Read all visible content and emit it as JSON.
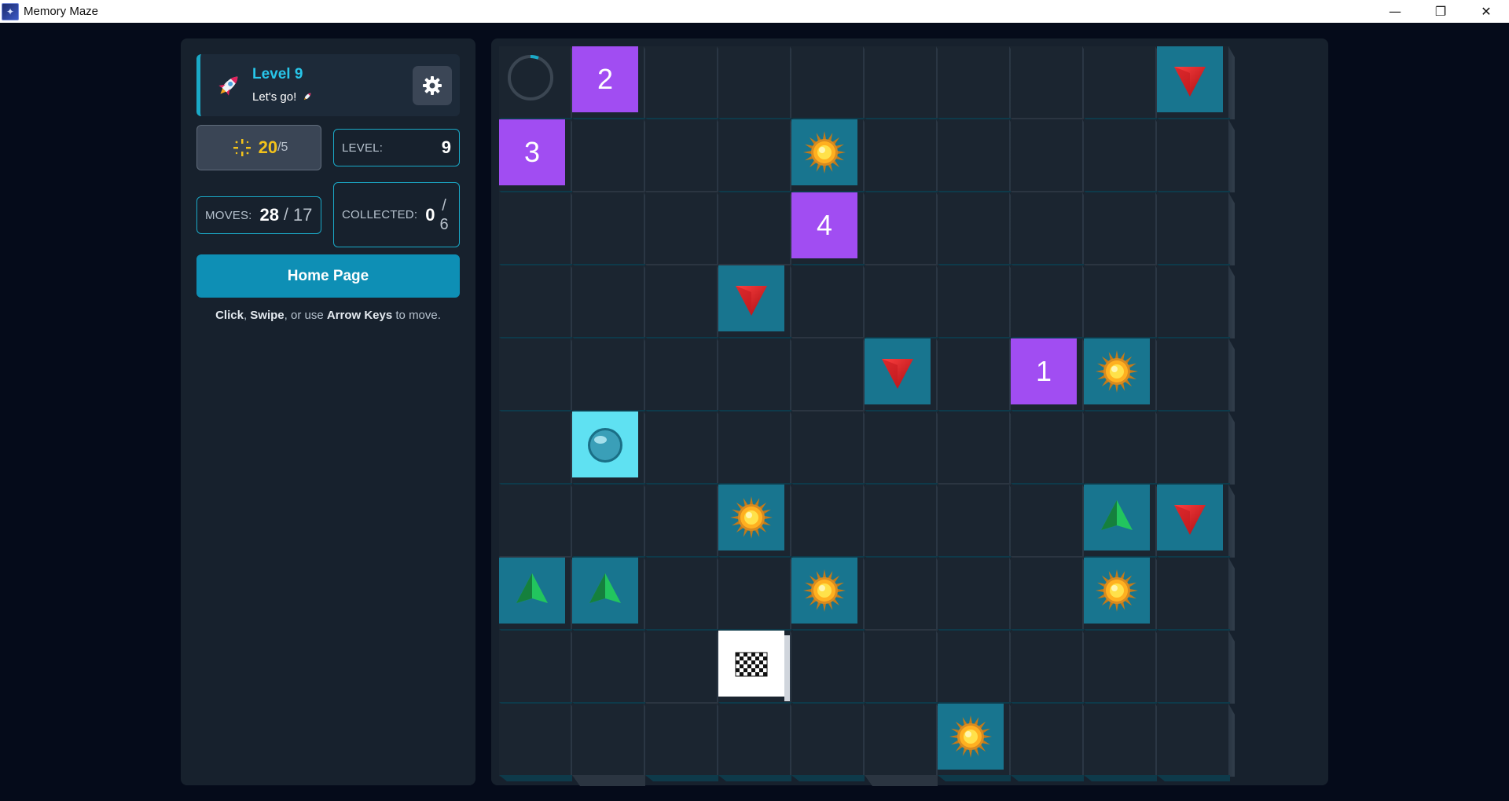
{
  "window": {
    "title": "Memory Maze",
    "controls": [
      "—",
      "❐",
      "✕"
    ]
  },
  "panel": {
    "level_title": "Level 9",
    "level_sub": "Let's go!",
    "score_main": "20",
    "score_sub": "/5",
    "level_label": "LEVEL:",
    "level_value": "9",
    "moves_label": "MOVES:",
    "moves_value": "28",
    "moves_sep": "/",
    "moves_max": "17",
    "collected_label": "COLLECTED:",
    "collected_value": "0",
    "collected_sep": "/",
    "collected_total": "6",
    "home_button": "Home Page",
    "hint": {
      "click": "Click",
      "comma": ", ",
      "swipe": "Swipe",
      "or_use": ", or use ",
      "arrow_keys": "Arrow Keys",
      "to_move": " to move."
    }
  },
  "board": {
    "rows": 10,
    "cols": 10,
    "timer_progress": 0.06,
    "colors": {
      "tile": "#18758f",
      "memo": "#a14df2",
      "player": "#5fe1f2",
      "accent": "#1aa9c7"
    },
    "tiles": [
      {
        "row": 0,
        "col": 1,
        "type": "memo",
        "label": "2"
      },
      {
        "row": 0,
        "col": 9,
        "type": "down-arrow"
      },
      {
        "row": 1,
        "col": 0,
        "type": "memo",
        "label": "3"
      },
      {
        "row": 1,
        "col": 4,
        "type": "sun"
      },
      {
        "row": 2,
        "col": 4,
        "type": "memo",
        "label": "4"
      },
      {
        "row": 3,
        "col": 3,
        "type": "down-arrow"
      },
      {
        "row": 4,
        "col": 5,
        "type": "down-arrow"
      },
      {
        "row": 4,
        "col": 7,
        "type": "memo",
        "label": "1"
      },
      {
        "row": 4,
        "col": 8,
        "type": "sun"
      },
      {
        "row": 5,
        "col": 1,
        "type": "player"
      },
      {
        "row": 6,
        "col": 3,
        "type": "sun"
      },
      {
        "row": 6,
        "col": 8,
        "type": "up-arrow"
      },
      {
        "row": 6,
        "col": 9,
        "type": "down-arrow"
      },
      {
        "row": 7,
        "col": 0,
        "type": "up-arrow"
      },
      {
        "row": 7,
        "col": 1,
        "type": "up-arrow"
      },
      {
        "row": 7,
        "col": 4,
        "type": "sun"
      },
      {
        "row": 7,
        "col": 8,
        "type": "sun"
      },
      {
        "row": 8,
        "col": 3,
        "type": "finish"
      },
      {
        "row": 9,
        "col": 6,
        "type": "sun"
      }
    ],
    "wall_bottom_cells": [
      [
        0,
        7
      ],
      [
        1,
        1
      ],
      [
        1,
        2
      ],
      [
        1,
        7
      ],
      [
        2,
        2
      ],
      [
        2,
        3
      ],
      [
        2,
        5
      ],
      [
        2,
        8
      ],
      [
        3,
        4
      ],
      [
        4,
        4
      ],
      [
        5,
        6
      ],
      [
        6,
        0
      ],
      [
        6,
        7
      ],
      [
        7,
        5
      ],
      [
        8,
        2
      ],
      [
        9,
        1
      ],
      [
        9,
        5
      ]
    ]
  }
}
